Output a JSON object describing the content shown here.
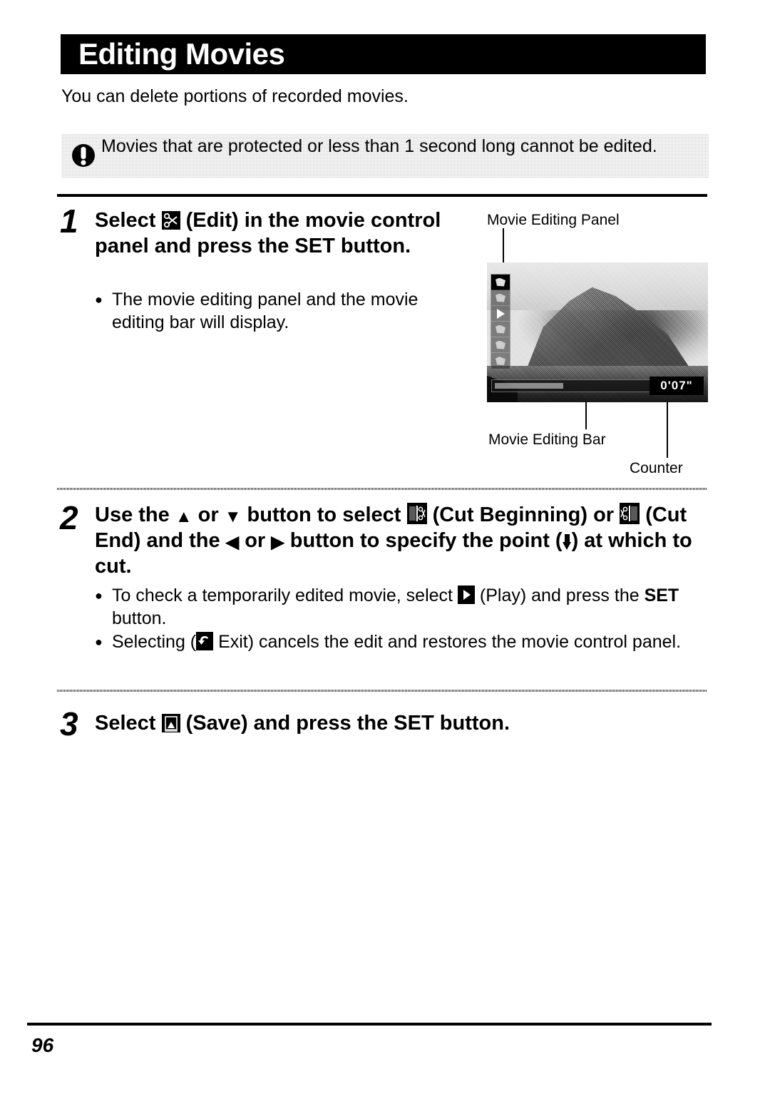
{
  "header": {
    "title": "Editing Movies"
  },
  "intro": {
    "text": "You can delete portions of recorded movies."
  },
  "note": {
    "icon": "exclamation-circle-icon",
    "text": "Movies that are protected or less than 1 second long cannot be edited."
  },
  "steps": [
    {
      "number": "1",
      "head_parts": {
        "p1": "Select",
        "icon": "scissors-edit-icon",
        "p2": "(Edit) in the movie control panel and press the",
        "set": "SET",
        "p3": "button."
      },
      "bullets": [
        "The movie editing panel and the movie editing bar will display."
      ]
    },
    {
      "number": "2",
      "head_parts": {
        "p1": "Use the",
        "arrow_up": "▲",
        "p2": "or",
        "arrow_down": "▼",
        "p3": "button to select",
        "icon_cut_begin": "cut-beginning-icon",
        "p4": "(Cut Beginning) or",
        "icon_cut_end": "cut-end-icon",
        "p5": "(Cut End) and the",
        "arrow_left": "◀",
        "p6": "or",
        "arrow_right": "▶",
        "p7": "button to specify the point (",
        "point_marker": "down-marker-icon",
        "p8": ") at which to cut."
      },
      "bullets_rich": [
        {
          "p1": "To check a temporarily edited movie, select",
          "icon": "play-icon",
          "p2": "(Play) and press the",
          "set": "SET",
          "p3": "button."
        },
        {
          "p1": "Selecting (",
          "icon": "exit-icon",
          "p2": "Exit) cancels the edit and restores the movie control panel."
        }
      ]
    },
    {
      "number": "3",
      "head_parts": {
        "p1": "Select",
        "icon": "save-icon",
        "p2": "(Save) and press the",
        "set": "SET",
        "p3": "button."
      }
    }
  ],
  "figure": {
    "callouts": {
      "panel": "Movie Editing Panel",
      "bar": "Movie Editing Bar",
      "counter": "Counter"
    },
    "lcd": {
      "counter_value": "0'07\"",
      "panel_icons": [
        "cut-beginning-icon",
        "cut-end-icon",
        "play-icon",
        "save-icon",
        "exit-icon",
        "extra-icon"
      ]
    }
  },
  "footer": {
    "page_number": "96"
  }
}
